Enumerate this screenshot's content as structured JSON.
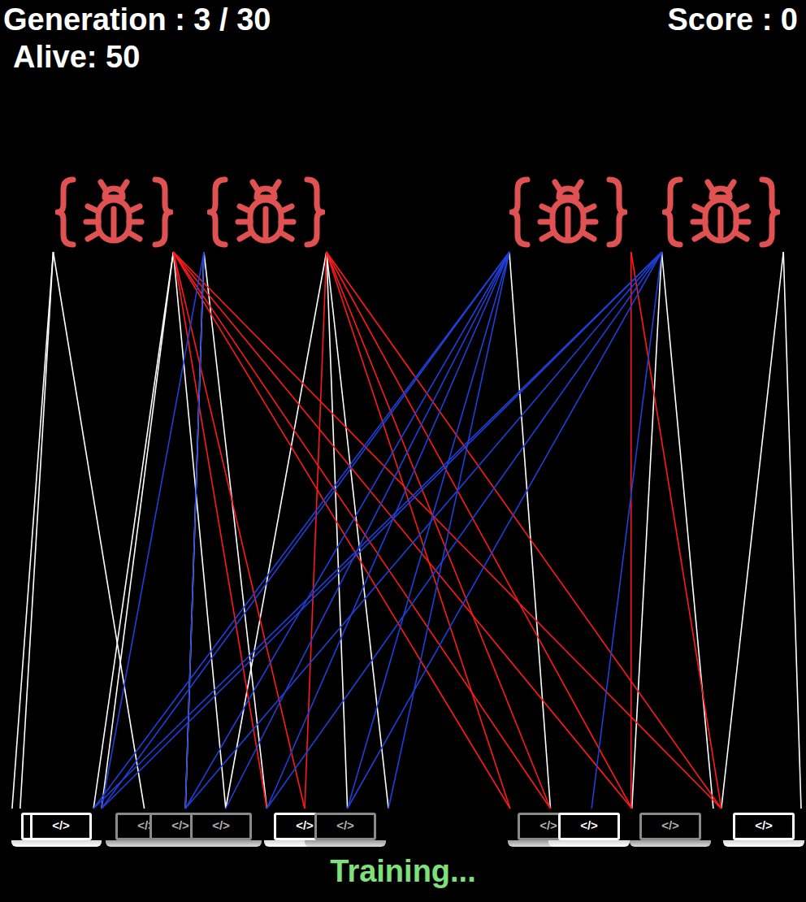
{
  "header": {
    "generation": "Generation : 3 / 30",
    "score": "Score : 0",
    "alive": "Alive: 50"
  },
  "bugs": [
    {
      "x": 0.141
    },
    {
      "x": 0.33
    },
    {
      "x": 0.705
    },
    {
      "x": 0.894
    }
  ],
  "laptops": [
    {
      "label": "</>",
      "x": 0.065,
      "active": true
    },
    {
      "label": "</>",
      "x": 0.076,
      "active": true
    },
    {
      "label": "</>",
      "x": 0.181,
      "active": false
    },
    {
      "label": "</>",
      "x": 0.224,
      "active": false
    },
    {
      "label": "</>",
      "x": 0.274,
      "active": false
    },
    {
      "label": "</>",
      "x": 0.378,
      "active": true
    },
    {
      "label": "</>",
      "x": 0.428,
      "active": false
    },
    {
      "label": "</>",
      "x": 0.68,
      "active": false
    },
    {
      "label": "</>",
      "x": 0.731,
      "active": true
    },
    {
      "label": "</>",
      "x": 0.832,
      "active": false
    },
    {
      "label": "</>",
      "x": 0.948,
      "active": true
    }
  ],
  "rays": [
    {
      "from": 0.066,
      "to": 0.015,
      "color": "#ffffff"
    },
    {
      "from": 0.066,
      "to": 0.025,
      "color": "#ffffff"
    },
    {
      "from": 0.066,
      "to": 0.179,
      "color": "#ffffff"
    },
    {
      "from": 0.215,
      "to": 0.116,
      "color": "#ffffff"
    },
    {
      "from": 0.215,
      "to": 0.126,
      "color": "#ffffff"
    },
    {
      "from": 0.215,
      "to": 0.28,
      "color": "#ffffff"
    },
    {
      "from": 0.253,
      "to": 0.23,
      "color": "#ffffff"
    },
    {
      "from": 0.253,
      "to": 0.331,
      "color": "#ffffff"
    },
    {
      "from": 0.405,
      "to": 0.28,
      "color": "#ffffff"
    },
    {
      "from": 0.405,
      "to": 0.431,
      "color": "#ffffff"
    },
    {
      "from": 0.405,
      "to": 0.482,
      "color": "#ffffff"
    },
    {
      "from": 0.632,
      "to": 0.683,
      "color": "#ffffff"
    },
    {
      "from": 0.821,
      "to": 0.784,
      "color": "#ffffff"
    },
    {
      "from": 0.821,
      "to": 0.885,
      "color": "#ffffff"
    },
    {
      "from": 0.972,
      "to": 0.895,
      "color": "#ffffff"
    },
    {
      "from": 0.972,
      "to": 0.994,
      "color": "#ffffff"
    },
    {
      "from": 0.215,
      "to": 0.331,
      "color": "#ff1a1a"
    },
    {
      "from": 0.215,
      "to": 0.378,
      "color": "#ff1a1a"
    },
    {
      "from": 0.215,
      "to": 0.633,
      "color": "#ff1a1a"
    },
    {
      "from": 0.215,
      "to": 0.683,
      "color": "#ff1a1a"
    },
    {
      "from": 0.215,
      "to": 0.784,
      "color": "#ff1a1a"
    },
    {
      "from": 0.215,
      "to": 0.895,
      "color": "#ff1a1a"
    },
    {
      "from": 0.405,
      "to": 0.378,
      "color": "#ff1a1a"
    },
    {
      "from": 0.405,
      "to": 0.633,
      "color": "#ff1a1a"
    },
    {
      "from": 0.405,
      "to": 0.683,
      "color": "#ff1a1a"
    },
    {
      "from": 0.405,
      "to": 0.784,
      "color": "#ff1a1a"
    },
    {
      "from": 0.405,
      "to": 0.895,
      "color": "#ff1a1a"
    },
    {
      "from": 0.783,
      "to": 0.783,
      "color": "#ff1a1a"
    },
    {
      "from": 0.783,
      "to": 0.895,
      "color": "#ff1a1a"
    },
    {
      "from": 0.632,
      "to": 0.116,
      "color": "#1f3fd8"
    },
    {
      "from": 0.632,
      "to": 0.126,
      "color": "#1f3fd8"
    },
    {
      "from": 0.632,
      "to": 0.23,
      "color": "#1f3fd8"
    },
    {
      "from": 0.632,
      "to": 0.28,
      "color": "#1f3fd8"
    },
    {
      "from": 0.632,
      "to": 0.331,
      "color": "#1f3fd8"
    },
    {
      "from": 0.632,
      "to": 0.431,
      "color": "#1f3fd8"
    },
    {
      "from": 0.632,
      "to": 0.482,
      "color": "#1f3fd8"
    },
    {
      "from": 0.821,
      "to": 0.116,
      "color": "#1f3fd8"
    },
    {
      "from": 0.821,
      "to": 0.126,
      "color": "#1f3fd8"
    },
    {
      "from": 0.821,
      "to": 0.23,
      "color": "#1f3fd8"
    },
    {
      "from": 0.821,
      "to": 0.331,
      "color": "#1f3fd8"
    },
    {
      "from": 0.821,
      "to": 0.431,
      "color": "#1f3fd8"
    },
    {
      "from": 0.821,
      "to": 0.734,
      "color": "#1f3fd8"
    },
    {
      "from": 0.253,
      "to": 0.23,
      "color": "#1f3fd8"
    },
    {
      "from": 0.253,
      "to": 0.126,
      "color": "#1f3fd8"
    }
  ],
  "status": "Training..."
}
